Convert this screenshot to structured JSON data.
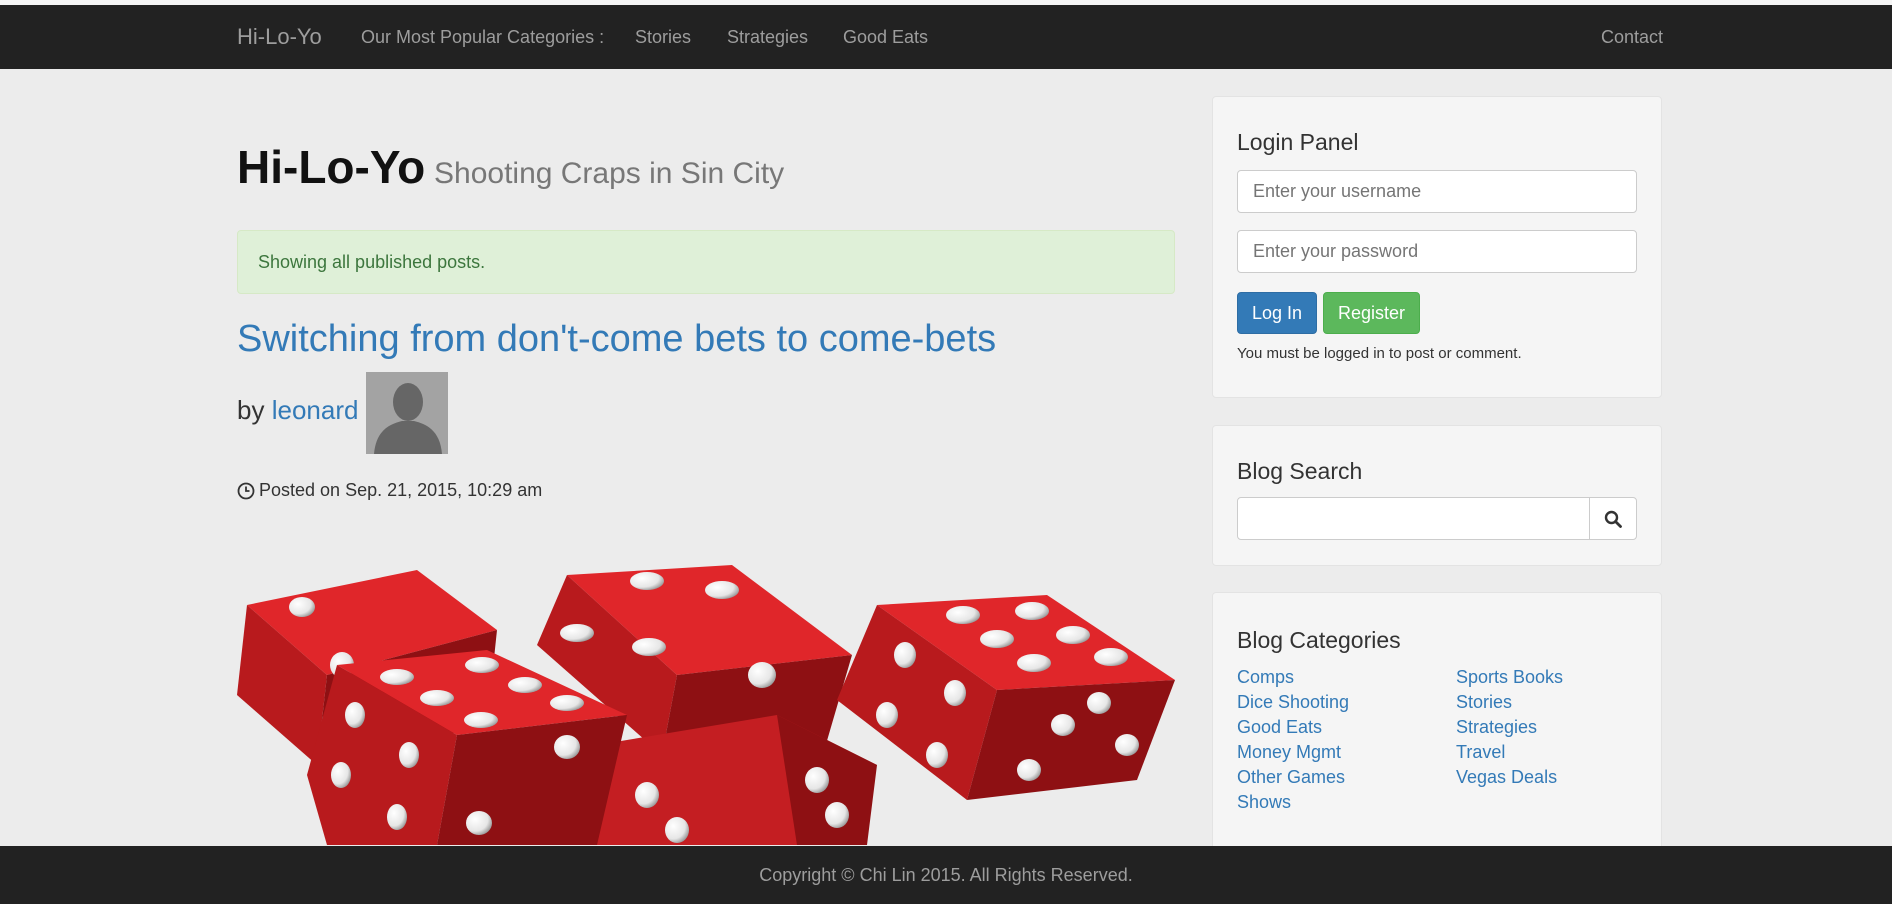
{
  "navbar": {
    "brand": "Hi-Lo-Yo",
    "categories_label": "Our Most Popular Categories :",
    "links": [
      "Stories",
      "Strategies",
      "Good Eats"
    ],
    "contact": "Contact"
  },
  "header": {
    "title": "Hi-Lo-Yo",
    "subtitle": "Shooting Craps in Sin City"
  },
  "alert": {
    "text": "Showing all published posts."
  },
  "post": {
    "title": "Switching from don't-come bets to come-bets",
    "by_label": "by",
    "author": "leonard",
    "posted": "Posted on Sep. 21, 2015, 10:29 am"
  },
  "login": {
    "heading": "Login Panel",
    "username_placeholder": "Enter your username",
    "password_placeholder": "Enter your password",
    "login_label": "Log In",
    "register_label": "Register",
    "note": "You must be logged in to post or comment."
  },
  "search": {
    "heading": "Blog Search",
    "value": ""
  },
  "categories": {
    "heading": "Blog Categories",
    "left": [
      "Comps",
      "Dice Shooting",
      "Good Eats",
      "Money Mgmt",
      "Other Games",
      "Shows"
    ],
    "right": [
      "Sports Books",
      "Stories",
      "Strategies",
      "Travel",
      "Vegas Deals"
    ]
  },
  "footer": {
    "text": "Copyright © Chi Lin 2015. All Rights Reserved."
  },
  "colors": {
    "navbar": "#222222",
    "link": "#337ab7",
    "success": "#5cb85c",
    "primary": "#337ab7",
    "dice": "#c8181c"
  }
}
